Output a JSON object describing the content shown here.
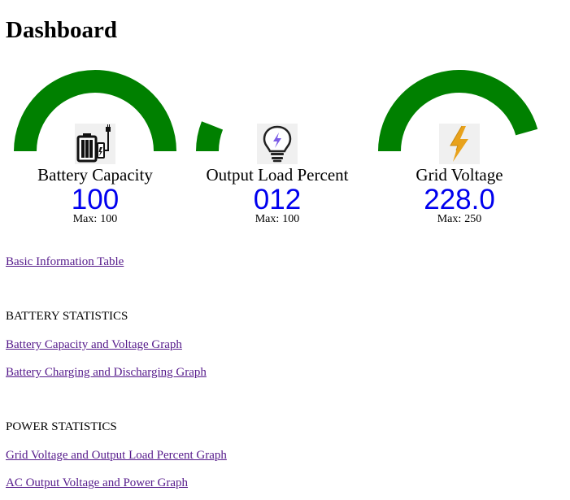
{
  "page": {
    "title": "Dashboard"
  },
  "gauges": [
    {
      "label": "Battery Capacity",
      "value": "100",
      "max_prefix": "Max:",
      "max": "100",
      "fraction": 1.0,
      "icon": "battery-charger-icon",
      "color": "#008000"
    },
    {
      "label": "Output Load Percent",
      "value": "012",
      "max_prefix": "Max:",
      "max": "100",
      "fraction": 0.12,
      "icon": "light-bulb-icon",
      "color": "#008000"
    },
    {
      "label": "Grid Voltage",
      "value": "228.0",
      "max_prefix": "Max:",
      "max": "250",
      "fraction": 0.912,
      "icon": "lightning-bolt-icon",
      "color": "#008000"
    }
  ],
  "links": {
    "basic_info": "Basic Information Table",
    "battery_capacity_voltage": "Battery Capacity and Voltage Graph",
    "battery_charging": "Battery Charging and Discharging Graph",
    "grid_voltage_output_load": "Grid Voltage and Output Load Percent Graph",
    "ac_output": "AC Output Voltage and Power Graph"
  },
  "sections": {
    "battery": "BATTERY STATISTICS",
    "power": "POWER STATISTICS"
  },
  "colors": {
    "gauge": "#008000",
    "value_text": "#0000ee",
    "link": "#551a8b"
  }
}
